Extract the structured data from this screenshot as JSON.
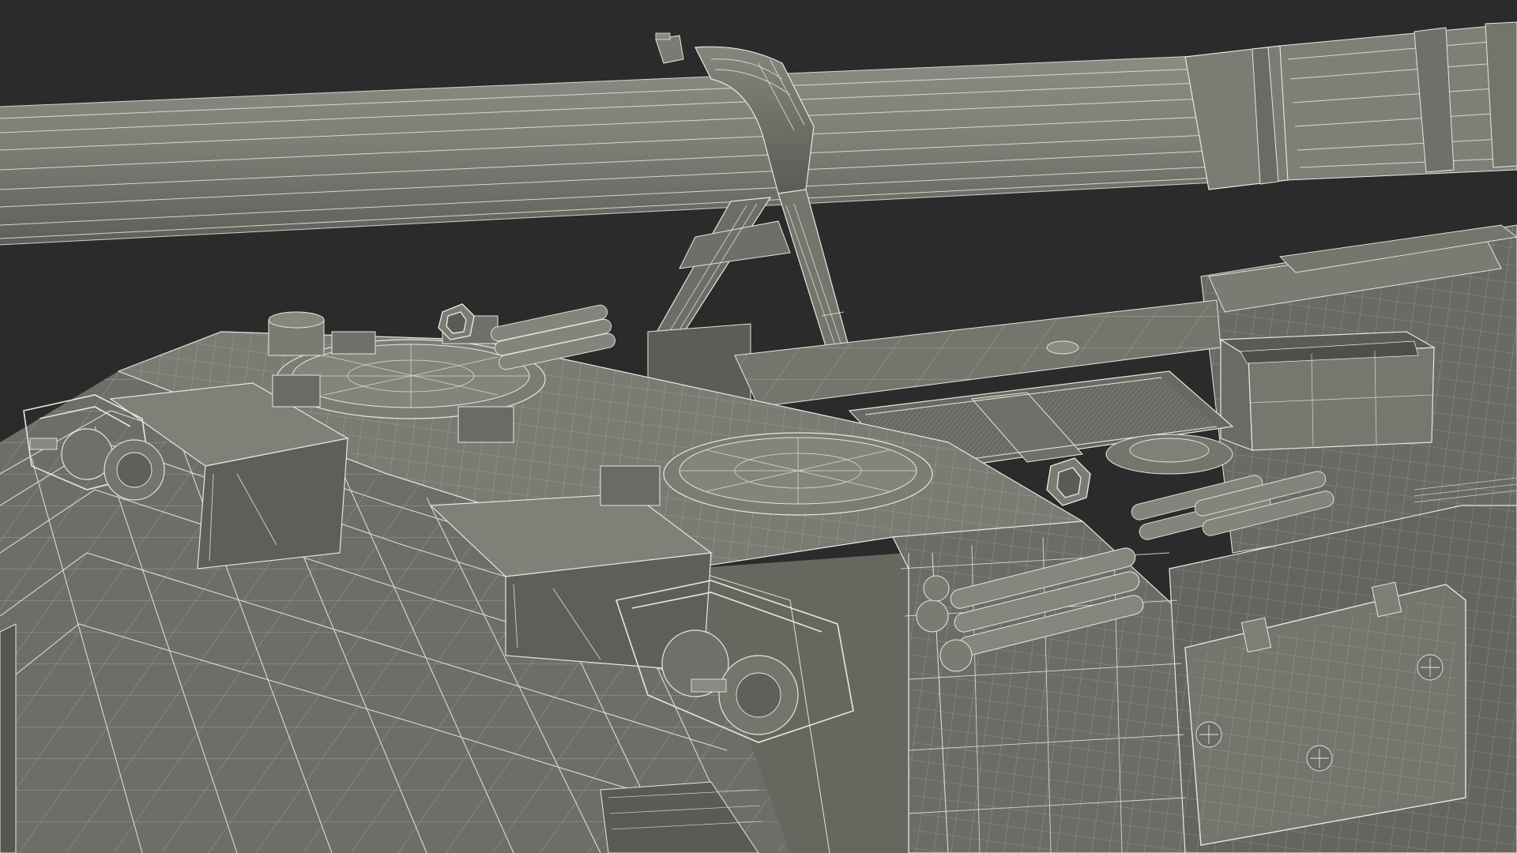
{
  "scene": {
    "subject": "tracked-artillery-hull-wireframe",
    "render_mode": "wireframe-overlay",
    "colors": {
      "background": "#2a2b2b",
      "surface_light": "#7c7d74",
      "surface_mid": "#6d6e66",
      "surface_dark": "#5a5b54",
      "surface_shadow": "#4a4b45",
      "wire": "#e6e8e0"
    }
  }
}
